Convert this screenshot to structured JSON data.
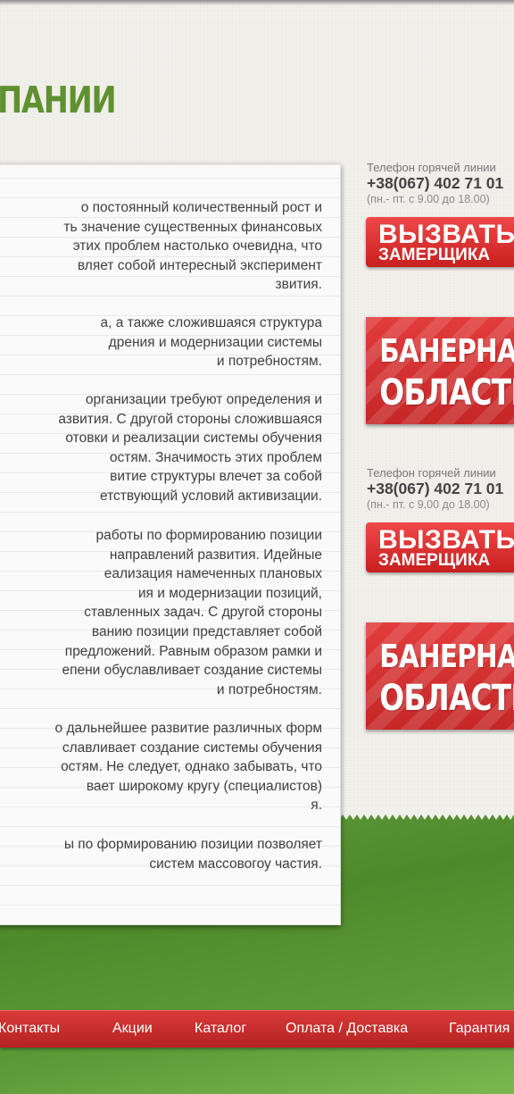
{
  "page": {
    "title": "ПАНИИ"
  },
  "content": {
    "paragraphs": [
      "о постоянный количественный рост и\nть значение существенных финансовых\n этих проблем настолько очевидна, что\nвляет собой интересный эксперимент\nзвития.",
      "а, а также сложившаяся структура\nдрения и модернизации системы\nи потребностям.",
      " организации требуют определения и\nазвития. С другой стороны сложившаяся\nотовки и реализации системы обучения\nостям. Значимость этих проблем\nвитие структуры влечет за собой\nетствующий условий активизации.",
      " работы по формированию позиции\nнаправлений развития. Идейные\nеализация намеченных плановых\nия и модернизации позиций,\nставленных задач. С другой стороны\nванию позиции представляет собой\nпредложений. Равным образом рамки и\nепени обуславливает создание системы\nи потребностям.",
      "о дальнейшее развитие различных форм\nславливает создание системы обучения\nостям. Не следует, однако забывать, что\nвает широкому кругу (специалистов)\nя.",
      "ы по формированию позиции позволяет\n систем массовогоу частия."
    ]
  },
  "sidebar": {
    "blocks": [
      {
        "hotline_label": "Телефон горячей линии",
        "phone": "+38(067) 402 71 01",
        "hours": "(пн.- пт. с 9.00 до 18.00)",
        "call_line1": "ВЫЗВАТЬ",
        "call_line2": "ЗАМЕРЩИКА",
        "banner_line1": "БАНЕРНАЯ",
        "banner_line2": "ОБЛАСТЬ"
      },
      {
        "hotline_label": "Телефон горячей линии",
        "phone": "+38(067) 402 71 01",
        "hours": "(пн.- пт. с 9.00 до 18.00)",
        "call_line1": "ВЫЗВАТЬ",
        "call_line2": "ЗАМЕРЩИКА",
        "banner_line1": "БАНЕРНАЯ",
        "banner_line2": "ОБЛАСТЬ"
      }
    ]
  },
  "nav": {
    "items": [
      "Контакты",
      "Акции",
      "Каталог",
      "Оплата / Доставка",
      "Гарантия"
    ]
  },
  "colors": {
    "title_green": "#5f9130",
    "accent_red": "#d73a38",
    "footer_green": "#4e8a2b"
  }
}
